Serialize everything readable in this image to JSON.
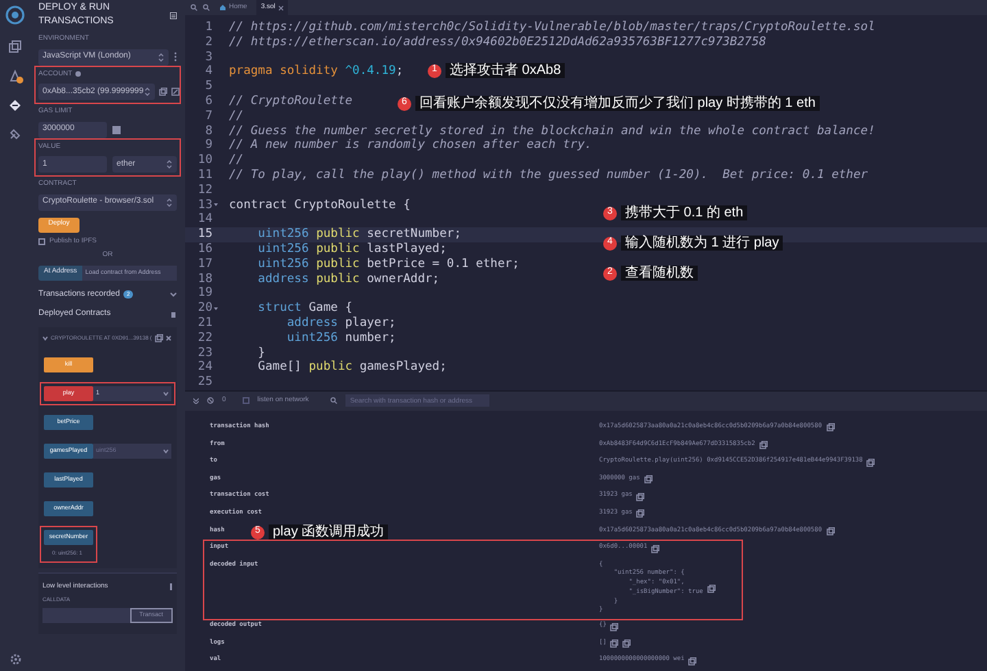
{
  "panel": {
    "title": "DEPLOY & RUN TRANSACTIONS",
    "environment": {
      "label": "ENVIRONMENT",
      "value": "JavaScript VM (London)"
    },
    "account": {
      "label": "ACCOUNT",
      "value": "0xAb8...35cb2 (99.9999999",
      "highlighted": true
    },
    "gas_limit": {
      "label": "GAS LIMIT",
      "value": "3000000"
    },
    "value": {
      "label": "VALUE",
      "amount": "1",
      "unit": "ether",
      "highlighted": true
    },
    "contract": {
      "label": "CONTRACT",
      "value": "CryptoRoulette - browser/3.sol"
    },
    "deploy_button": "Deploy",
    "publish": {
      "label": "Publish to IPFS",
      "checked": false
    },
    "or_label": "OR",
    "at_address_button": "At Address",
    "address_placeholder": "Load contract from Address",
    "transactions_recorded": {
      "label": "Transactions recorded",
      "count": "2"
    },
    "deployed_contracts": "Deployed Contracts",
    "instance": "CRYPTOROULETTE AT 0XD91...39138 (",
    "functions": [
      {
        "name": "kill",
        "kind": "payable",
        "highlighted": false
      },
      {
        "name": "play",
        "kind": "payable-input",
        "value": "1",
        "highlighted": true
      },
      {
        "name": "betPrice",
        "kind": "call",
        "highlighted": false
      },
      {
        "name": "gamesPlayed",
        "kind": "call-input",
        "placeholder": "uint256",
        "highlighted": false
      },
      {
        "name": "lastPlayed",
        "kind": "call",
        "highlighted": false
      },
      {
        "name": "ownerAddr",
        "kind": "call",
        "highlighted": false
      },
      {
        "name": "secretNumber",
        "kind": "call",
        "result": "0: uint256: 1",
        "highlighted": true
      }
    ],
    "low_level": {
      "title": "Low level interactions",
      "calldata_label": "CALLDATA",
      "transact_button": "Transact"
    }
  },
  "tabs": [
    {
      "label": "Home",
      "selected": false
    },
    {
      "label": "3.sol",
      "selected": true
    }
  ],
  "code": [
    {
      "number": "1",
      "tokens": [
        {
          "kind": "comment",
          "text": "// https://github.com/misterch0c/Solidity-Vulnerable/blob/master/traps/CryptoRoulette.sol"
        }
      ]
    },
    {
      "number": "2",
      "tokens": [
        {
          "kind": "comment",
          "text": "// https://etherscan.io/address/0x94602b0E2512DdAd62a935763BF1277c973B2758"
        }
      ]
    },
    {
      "number": "3"
    },
    {
      "number": "4",
      "tokens": [
        {
          "kind": "keyword",
          "text": "pragma solidity "
        },
        {
          "kind": "version",
          "text": "^0.4.19"
        },
        {
          "kind": "plain",
          "text": ";"
        }
      ]
    },
    {
      "number": "5"
    },
    {
      "number": "6",
      "tokens": [
        {
          "kind": "comment",
          "text": "// CryptoRoulette"
        }
      ]
    },
    {
      "number": "7",
      "tokens": [
        {
          "kind": "comment",
          "text": "//"
        }
      ]
    },
    {
      "number": "8",
      "tokens": [
        {
          "kind": "comment",
          "text": "// Guess the number secretly stored in the blockchain and win the whole contract balance!"
        }
      ]
    },
    {
      "number": "9",
      "tokens": [
        {
          "kind": "comment",
          "text": "// A new number is randomly chosen after each try."
        }
      ]
    },
    {
      "number": "10",
      "tokens": [
        {
          "kind": "comment",
          "text": "//"
        }
      ]
    },
    {
      "number": "11",
      "tokens": [
        {
          "kind": "comment",
          "text": "// To play, call the play() method with the guessed number (1-20).  Bet price: 0.1 ether"
        }
      ]
    },
    {
      "number": "12"
    },
    {
      "number": "13",
      "foldable": true,
      "tokens": [
        {
          "kind": "plain",
          "text": "contract CryptoRoulette {"
        }
      ]
    },
    {
      "number": "14"
    },
    {
      "number": "15",
      "current": true,
      "tokens": [
        {
          "kind": "type",
          "text": "    uint256 "
        },
        {
          "kind": "modifier",
          "text": "public"
        },
        {
          "kind": "plain",
          "text": " secretNumber;"
        }
      ]
    },
    {
      "number": "16",
      "tokens": [
        {
          "kind": "type",
          "text": "    uint256 "
        },
        {
          "kind": "modifier",
          "text": "public"
        },
        {
          "kind": "plain",
          "text": " lastPlayed;"
        }
      ]
    },
    {
      "number": "17",
      "tokens": [
        {
          "kind": "type",
          "text": "    uint256 "
        },
        {
          "kind": "modifier",
          "text": "public"
        },
        {
          "kind": "plain",
          "text": " betPrice = 0.1 ether;"
        }
      ]
    },
    {
      "number": "18",
      "tokens": [
        {
          "kind": "type",
          "text": "    address "
        },
        {
          "kind": "modifier",
          "text": "public"
        },
        {
          "kind": "plain",
          "text": " ownerAddr;"
        }
      ]
    },
    {
      "number": "19"
    },
    {
      "number": "20",
      "foldable": true,
      "tokens": [
        {
          "kind": "type",
          "text": "    struct"
        },
        {
          "kind": "plain",
          "text": " Game {"
        }
      ]
    },
    {
      "number": "21",
      "tokens": [
        {
          "kind": "type",
          "text": "        address"
        },
        {
          "kind": "plain",
          "text": " player;"
        }
      ]
    },
    {
      "number": "22",
      "tokens": [
        {
          "kind": "type",
          "text": "        uint256"
        },
        {
          "kind": "plain",
          "text": " number;"
        }
      ]
    },
    {
      "number": "23",
      "tokens": [
        {
          "kind": "plain",
          "text": "    }"
        }
      ]
    },
    {
      "number": "24",
      "tokens": [
        {
          "kind": "plain",
          "text": "    Game[] "
        },
        {
          "kind": "modifier",
          "text": "public"
        },
        {
          "kind": "plain",
          "text": " gamesPlayed;"
        }
      ]
    },
    {
      "number": "25"
    }
  ],
  "terminal": {
    "pending_count": "0",
    "listen": {
      "label": "listen on network",
      "checked": false
    },
    "search_placeholder": "Search with transaction hash or address",
    "rows": [
      {
        "key": "transaction hash",
        "value": "0x17a5d6025873aa80a0a21c0a8eb4c86cc0d5b0209b6a97a0b84e800580"
      },
      {
        "key": "from",
        "value": "0xAb8483F64d9C6d1EcF9b849Ae677dD3315835cb2"
      },
      {
        "key": "to",
        "value": "CryptoRoulette.play(uint256) 0xd9145CCE52D386f254917e481eB44e9943F39138"
      },
      {
        "key": "gas",
        "value": "3000000 gas"
      },
      {
        "key": "transaction cost",
        "value": "31923 gas"
      },
      {
        "key": "execution cost",
        "value": "31923 gas"
      },
      {
        "key": "hash",
        "value": "0x17a5d6025873aa80a0a21c0a8eb4c86cc0d5b0209b6a97a0b84e800580"
      },
      {
        "key": "input",
        "value": "0x6d0...00001",
        "highlighted": true
      },
      {
        "key": "decoded input",
        "value": "{\n\t\"uint256 number\": {\n\t\t\"_hex\": \"0x01\",\n\t\t\"_isBigNumber\": true\n\t}\n}",
        "highlighted": true
      },
      {
        "key": "decoded output",
        "value": "{}"
      },
      {
        "key": "logs",
        "value": "[]",
        "extra_icon": true
      },
      {
        "key": "val",
        "value": "1000000000000000000 wei"
      }
    ]
  },
  "annotations": [
    {
      "number": "1",
      "text": "选择攻击者 0xAb8"
    },
    {
      "number": "6",
      "text": "回看账户余额发现不仅没有增加反而少了我们 play 时携带的 1 eth"
    },
    {
      "number": "3",
      "text": "携带大于 0.1 的 eth"
    },
    {
      "number": "4",
      "text": "输入随机数为 1 进行 play"
    },
    {
      "number": "2",
      "text": "查看随机数"
    },
    {
      "number": "5",
      "text": "play 函数调用成功"
    }
  ]
}
